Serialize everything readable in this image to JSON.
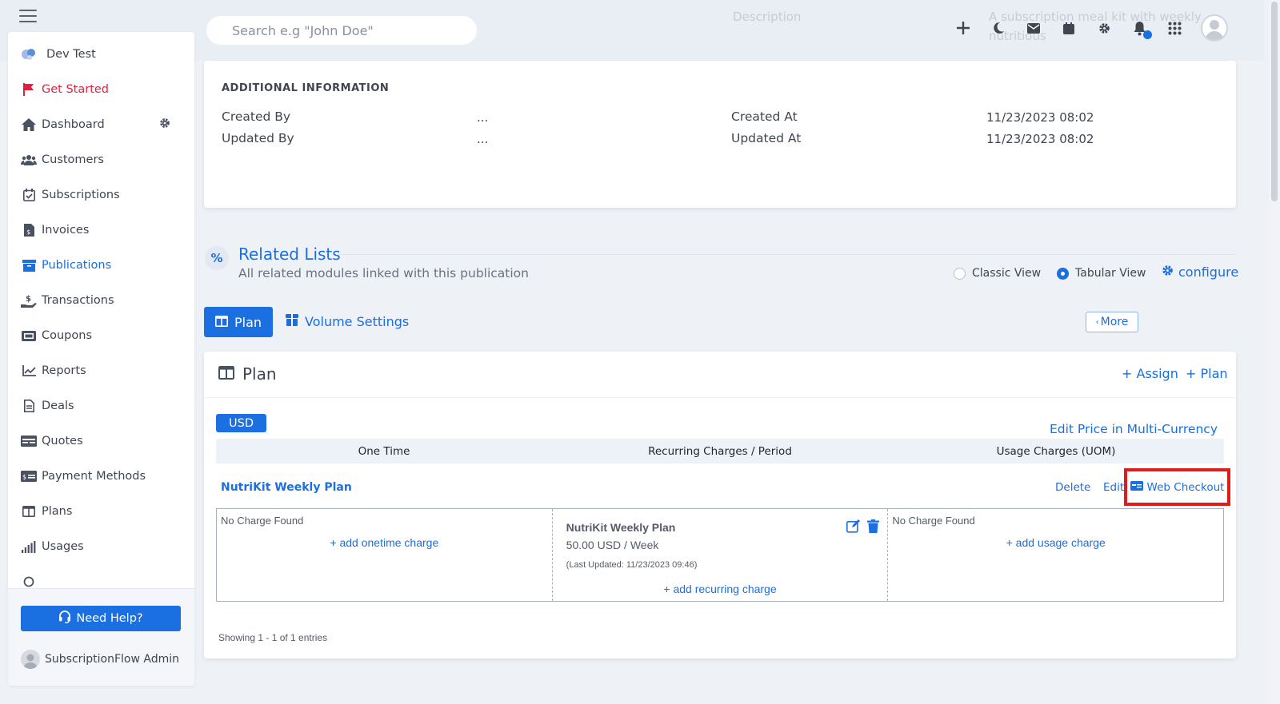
{
  "topbar": {
    "search_placeholder": "Search e.g \"John Doe\"",
    "ghost_label": "Description",
    "ghost_text_1": "A subscription meal kit with weekly",
    "ghost_text_2": "nutritious"
  },
  "sidebar": {
    "items": [
      {
        "label": "Dev Test",
        "icon": "org-logo-icon"
      },
      {
        "label": "Get Started",
        "icon": "flag-icon"
      },
      {
        "label": "Dashboard",
        "icon": "home-icon"
      },
      {
        "label": "Customers",
        "icon": "users-icon"
      },
      {
        "label": "Subscriptions",
        "icon": "calendar-check-icon"
      },
      {
        "label": "Invoices",
        "icon": "invoice-icon"
      },
      {
        "label": "Publications",
        "icon": "archive-icon"
      },
      {
        "label": "Transactions",
        "icon": "hand-money-icon"
      },
      {
        "label": "Coupons",
        "icon": "ticket-icon"
      },
      {
        "label": "Reports",
        "icon": "line-chart-icon"
      },
      {
        "label": "Deals",
        "icon": "file-icon"
      },
      {
        "label": "Quotes",
        "icon": "quote-card-icon"
      },
      {
        "label": "Payment Methods",
        "icon": "payment-card-icon"
      },
      {
        "label": "Plans",
        "icon": "columns-icon"
      },
      {
        "label": "Usages",
        "icon": "signal-bars-icon"
      }
    ],
    "help_label": "Need Help?",
    "admin_name": "SubscriptionFlow Admin"
  },
  "additional_info": {
    "title": "ADDITIONAL INFORMATION",
    "created_by_label": "Created By",
    "created_by_value": "...",
    "updated_by_label": "Updated By",
    "updated_by_value": "...",
    "created_at_label": "Created At",
    "created_at_value": "11/23/2023 08:02",
    "updated_at_label": "Updated At",
    "updated_at_value": "11/23/2023 08:02"
  },
  "related": {
    "title": "Related Lists",
    "subtitle": "All related modules linked with this publication",
    "classic_view": "Classic View",
    "tabular_view": "Tabular View",
    "configure": "configure",
    "selected_view": "Tabular View"
  },
  "tabs": {
    "plan": "Plan",
    "volume": "Volume Settings",
    "more": "More"
  },
  "plan_card": {
    "title": "Plan",
    "assign": "+ Assign",
    "add_plan": "+ Plan",
    "currency": "USD",
    "edit_multi": "Edit Price in Multi-Currency",
    "columns": [
      "One Time",
      "Recurring Charges / Period",
      "Usage Charges (UOM)"
    ],
    "plan_name": "NutriKit Weekly Plan",
    "delete": "Delete",
    "edit": "Edit",
    "web_checkout": "Web Checkout",
    "onetime_empty": "No Charge Found",
    "add_onetime": "+ add onetime charge",
    "recurring_name": "NutriKit Weekly Plan",
    "recurring_price": "50.00 USD / Week",
    "recurring_updated": "(Last Updated: 11/23/2023 09:46)",
    "add_recurring": "+ add recurring charge",
    "usage_empty": "No Charge Found",
    "add_usage": "+ add usage charge",
    "showing": "Showing 1 - 1 of 1 entries"
  },
  "colors": {
    "accent": "#1b6fe0",
    "danger": "#e0213c",
    "highlight": "#e01b1b"
  }
}
